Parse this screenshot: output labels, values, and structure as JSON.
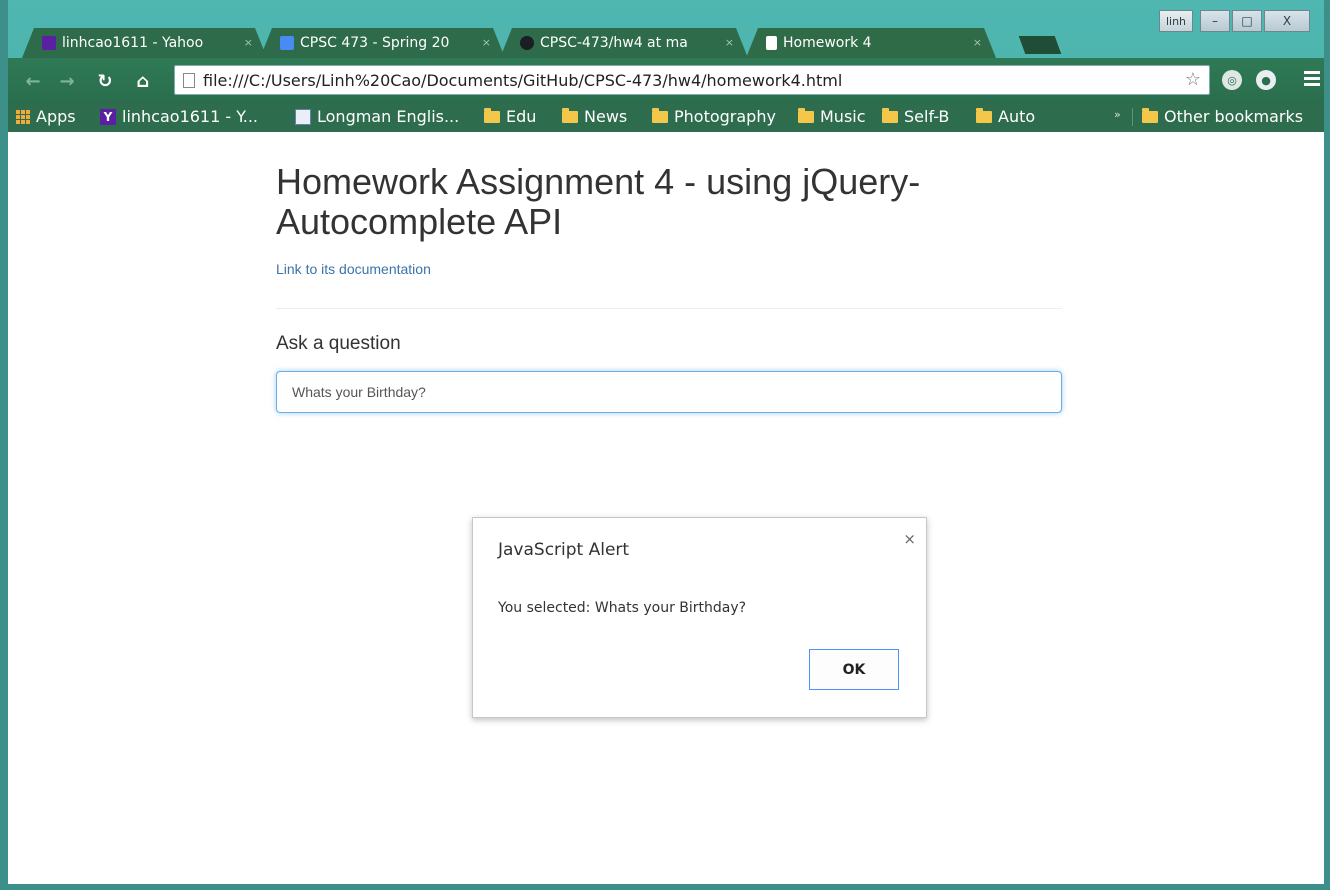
{
  "browser": {
    "tabs": [
      {
        "title": "linhcao1611 - Yahoo",
        "icon": "yahoo-mail-icon",
        "active": false
      },
      {
        "title": "CPSC 473 - Spring 20",
        "icon": "google-docs-icon",
        "active": false
      },
      {
        "title": "CPSC-473/hw4 at ma",
        "icon": "github-icon",
        "active": false
      },
      {
        "title": "Homework 4",
        "icon": "page-icon",
        "active": true
      }
    ],
    "tab_close_glyph": "×",
    "profile_name": "linh",
    "window_controls": {
      "minimize": "–",
      "maximize": "□",
      "close": "X"
    },
    "url": "file:///C:/Users/Linh%20Cao/Documents/GitHub/CPSC-473/hw4/homework4.html",
    "bookmarks": [
      {
        "label": "Apps",
        "icon": "apps-grid-icon"
      },
      {
        "label": "linhcao1611 - Y...",
        "icon": "yahoo-icon"
      },
      {
        "label": "Longman Englis...",
        "icon": "longman-icon"
      },
      {
        "label": "Edu",
        "icon": "folder-icon"
      },
      {
        "label": "News",
        "icon": "folder-icon"
      },
      {
        "label": "Photography",
        "icon": "folder-icon"
      },
      {
        "label": "Music",
        "icon": "folder-icon"
      },
      {
        "label": "Self-B",
        "icon": "folder-icon"
      },
      {
        "label": "Auto",
        "icon": "folder-icon"
      }
    ],
    "other_bookmarks": "Other bookmarks",
    "bookmarks_overflow": "»"
  },
  "page": {
    "title": "Homework Assignment 4 - using jQuery-Autocomplete API",
    "doc_link": "Link to its documentation",
    "ask_label": "Ask a question",
    "question_value": "Whats your Birthday?"
  },
  "alert": {
    "title": "JavaScript Alert",
    "message": "You selected: Whats your Birthday?",
    "ok_label": "OK",
    "close_glyph": "×"
  },
  "colors": {
    "frame": "#4fb6b0",
    "toolbar": "#2a6e4d",
    "link": "#3a74a8",
    "input_focus": "#66afe9"
  }
}
